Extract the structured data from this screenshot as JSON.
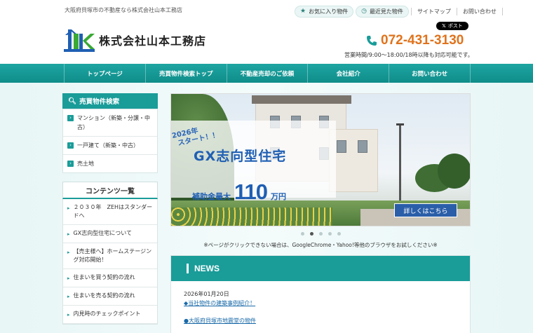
{
  "header": {
    "tagline": "大阪府貝塚市の不動産なら株式会社山本工務店",
    "favorites_label": "お気に入り物件",
    "recent_label": "最近見た物件",
    "sitemap_label": "サイトマップ",
    "contact_label": "お問い合わせ",
    "company_name": "株式会社山本工務店",
    "x_post_label": "ポスト",
    "phone": "072-431-3130",
    "hours": "営業時間/9:00～18:00/18時以降も対応可能です。"
  },
  "nav": {
    "items": [
      "トップページ",
      "売買物件検索トップ",
      "不動産売却のご依頼",
      "会社紹介",
      "お問い合わせ"
    ]
  },
  "sidebar": {
    "search_title": "売買物件検索",
    "categories": [
      "マンション（新築・分譲・中古）",
      "一戸建て（新築・中古）",
      "売土地"
    ],
    "contents_title": "コンテンツ一覧",
    "contents": [
      "２０３０年　ZEHはスタンダードへ",
      "GX志向型住宅について",
      "【売主様へ】ホームステージング対応開始！",
      "住まいを買う契約の流れ",
      "住まいを売る契約の流れ",
      "内見時のチェックポイント"
    ]
  },
  "slider": {
    "start_line1": "2026年",
    "start_line2": "スタート！！",
    "headline": "GX志向型住宅",
    "subsidy_label": "補助金最大",
    "subsidy_amount": "110",
    "subsidy_unit": "万円",
    "detail_button": "詳しくはこちら",
    "slide_count": 5,
    "active_slide": 2
  },
  "notice": "※ページがクリックできない場合は、GoogleChrome・Yahoo!等他のブラウザをお試しください※",
  "news": {
    "title": "NEWS",
    "items": [
      {
        "date": "2026年01月20日",
        "text": "◆当社物件の建築事例紹介！"
      },
      {
        "date": "",
        "text": "●大阪府貝塚市地震堂の物件"
      }
    ]
  },
  "colors": {
    "teal": "#1a9c99",
    "phone_orange": "#e0731c",
    "gx_blue": "#1f5fb3"
  }
}
